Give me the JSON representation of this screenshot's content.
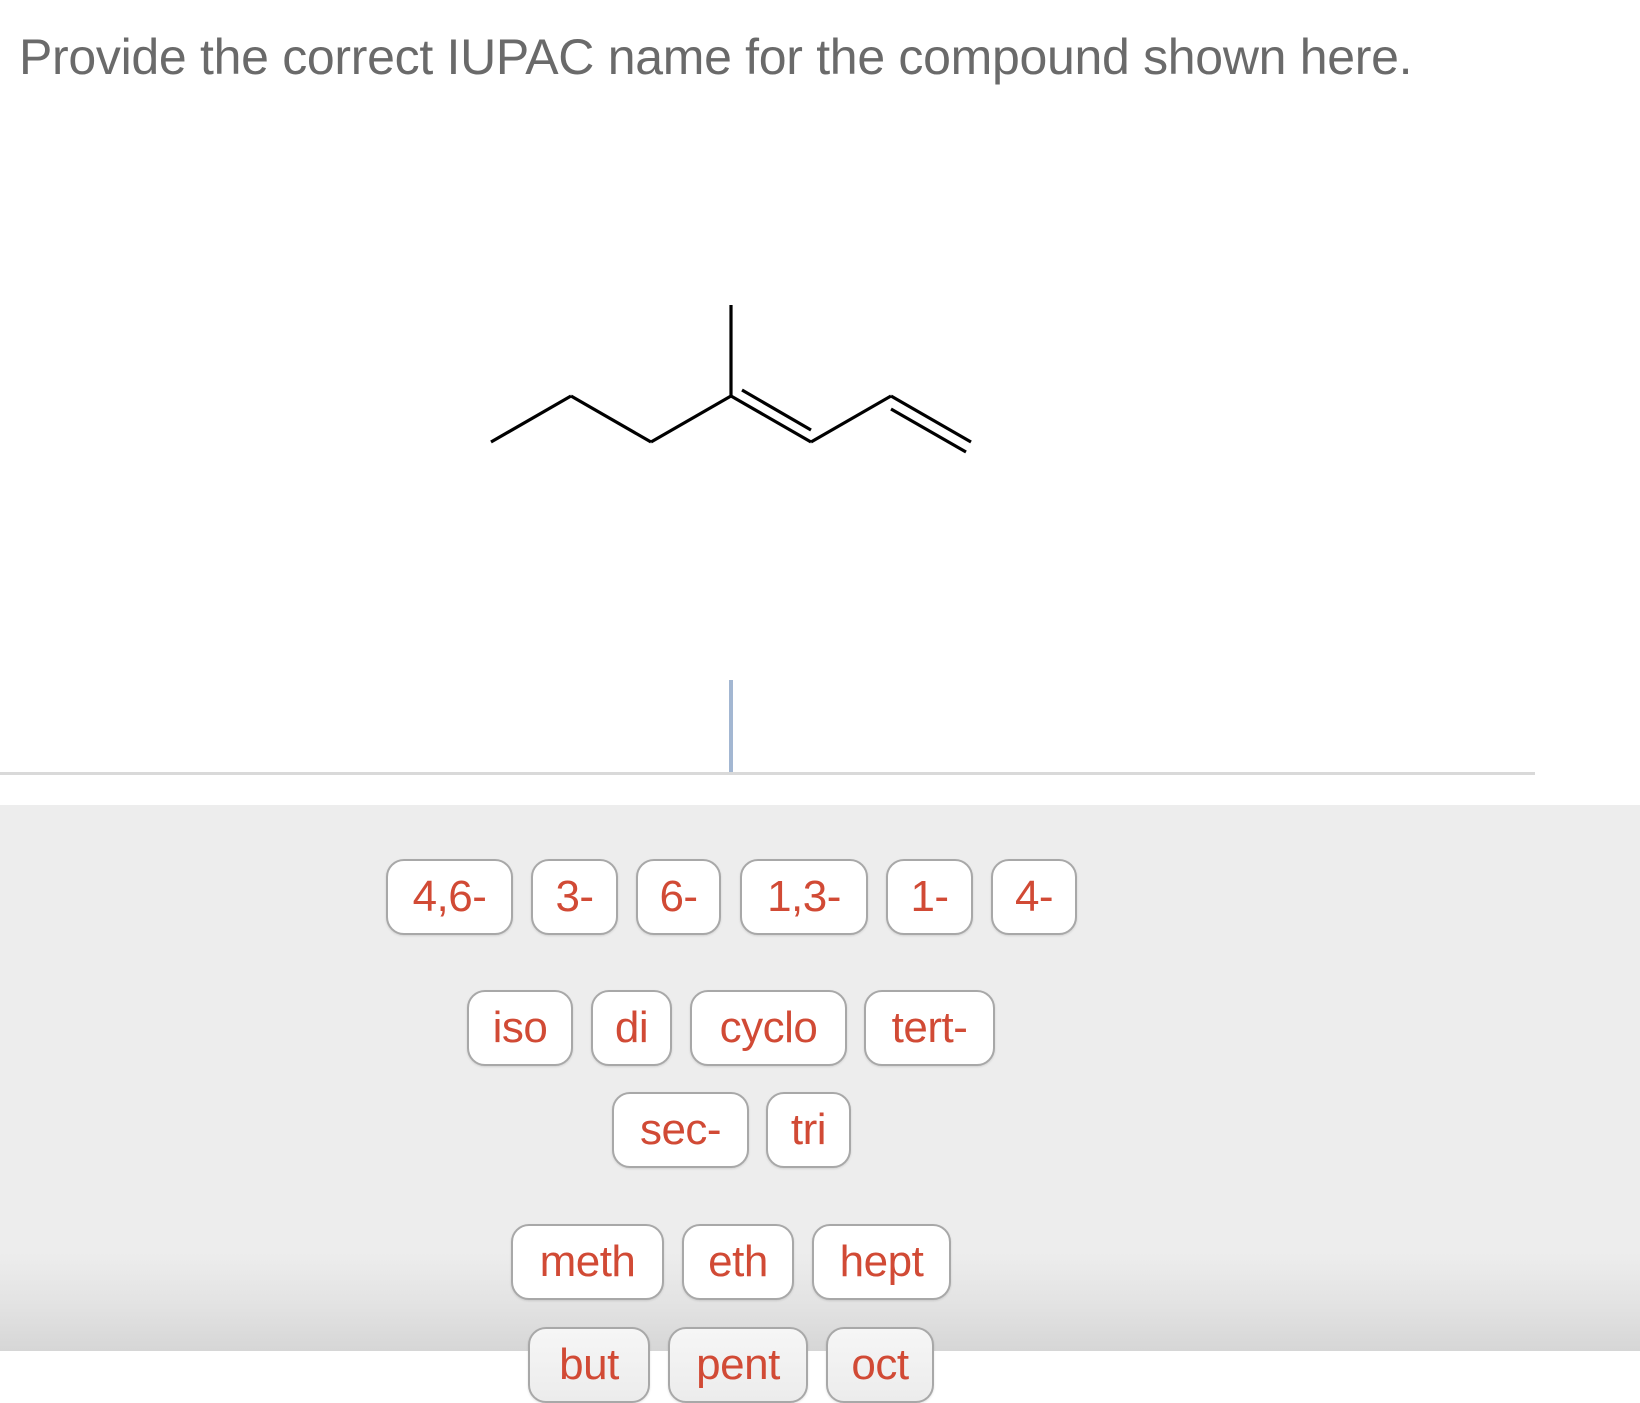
{
  "question": {
    "prompt": "Provide the correct IUPAC name for the compound shown here."
  },
  "structure": {
    "description": "skeletal formula: 4-methyl-1,3-heptadiene",
    "bond_color": "#000000"
  },
  "answer_field": {
    "value": "",
    "cursor_color": "#a3b7d2"
  },
  "tile_bank": {
    "text_color": "#d14a35",
    "locants": [
      "4,6-",
      "3-",
      "6-",
      "1,3-",
      "1-",
      "4-"
    ],
    "prefixes": [
      "iso",
      "di",
      "cyclo",
      "tert-"
    ],
    "prefixes_row2": [
      "sec-",
      "tri"
    ],
    "roots": [
      "meth",
      "eth",
      "hept"
    ],
    "roots_row2_partial": [
      "but",
      "pent",
      "oct"
    ]
  }
}
